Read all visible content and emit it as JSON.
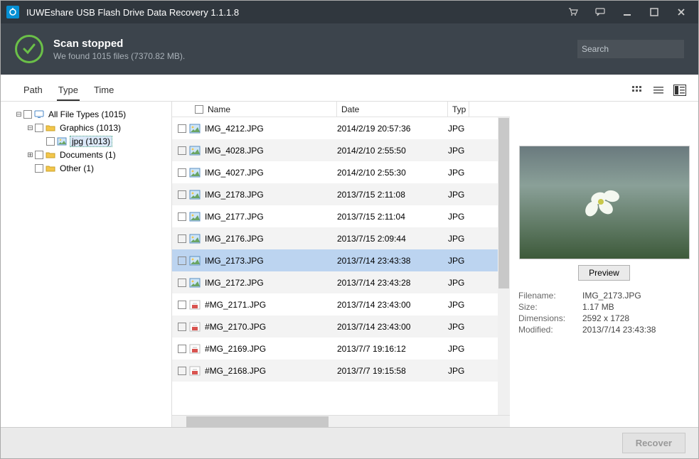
{
  "titlebar": {
    "title": "IUWEshare USB Flash Drive Data Recovery 1.1.1.8"
  },
  "status": {
    "heading": "Scan stopped",
    "sub": "We found 1015 files (7370.82 MB)."
  },
  "search": {
    "placeholder": "Search"
  },
  "tabs": {
    "path": "Path",
    "type": "Type",
    "time": "Time",
    "active": "type"
  },
  "tree": {
    "root": "All File Types (1015)",
    "graphics": "Graphics (1013)",
    "jpg": "jpg (1013)",
    "documents": "Documents (1)",
    "other": "Other (1)"
  },
  "columns": {
    "name": "Name",
    "date": "Date",
    "type": "Type"
  },
  "files": [
    {
      "name": "IMG_4212.JPG",
      "date": "2014/2/19 20:57:36",
      "type": "JPG",
      "icon": "img"
    },
    {
      "name": "IMG_4028.JPG",
      "date": "2014/2/10 2:55:50",
      "type": "JPG",
      "icon": "img"
    },
    {
      "name": "IMG_4027.JPG",
      "date": "2014/2/10 2:55:30",
      "type": "JPG",
      "icon": "img"
    },
    {
      "name": "IMG_2178.JPG",
      "date": "2013/7/15 2:11:08",
      "type": "JPG",
      "icon": "img"
    },
    {
      "name": "IMG_2177.JPG",
      "date": "2013/7/15 2:11:04",
      "type": "JPG",
      "icon": "img"
    },
    {
      "name": "IMG_2176.JPG",
      "date": "2013/7/15 2:09:44",
      "type": "JPG",
      "icon": "img"
    },
    {
      "name": "IMG_2173.JPG",
      "date": "2013/7/14 23:43:38",
      "type": "JPG",
      "icon": "img",
      "selected": true
    },
    {
      "name": "IMG_2172.JPG",
      "date": "2013/7/14 23:43:28",
      "type": "JPG",
      "icon": "img"
    },
    {
      "name": "#MG_2171.JPG",
      "date": "2013/7/14 23:43:00",
      "type": "JPG",
      "icon": "broken"
    },
    {
      "name": "#MG_2170.JPG",
      "date": "2013/7/14 23:43:00",
      "type": "JPG",
      "icon": "broken"
    },
    {
      "name": "#MG_2169.JPG",
      "date": "2013/7/7 19:16:12",
      "type": "JPG",
      "icon": "broken"
    },
    {
      "name": "#MG_2168.JPG",
      "date": "2013/7/7 19:15:58",
      "type": "JPG",
      "icon": "broken"
    }
  ],
  "preview": {
    "button": "Preview",
    "labels": {
      "filename": "Filename:",
      "size": "Size:",
      "dimensions": "Dimensions:",
      "modified": "Modified:"
    },
    "values": {
      "filename": "IMG_2173.JPG",
      "size": "1.17 MB",
      "dimensions": "2592 x 1728",
      "modified": "2013/7/14 23:43:38"
    }
  },
  "footer": {
    "recover": "Recover"
  }
}
